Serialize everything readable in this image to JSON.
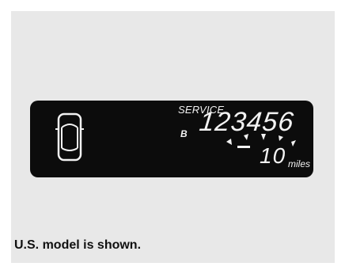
{
  "display": {
    "service_label": "SERVICE",
    "sub_item": "B",
    "odometer": "123456",
    "remaining": "10",
    "unit": "miles",
    "minus_sign": "-"
  },
  "caption": "U.S. model is shown.",
  "icons": {
    "vehicle": "car-top-view-icon",
    "indicator": "tick-marks-icon"
  },
  "colors": {
    "lcd_background": "#0c0c0c",
    "lcd_text": "#f2f2f2",
    "panel_background": "#e8e8e8"
  }
}
